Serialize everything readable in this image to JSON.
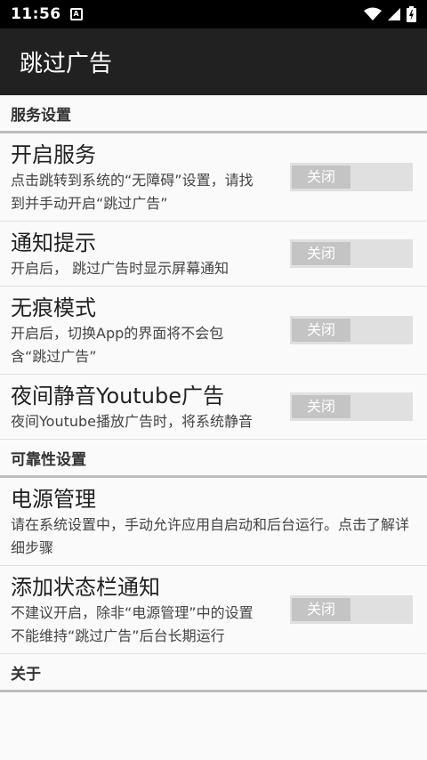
{
  "status_bar": {
    "time": "11:56",
    "notification_letter": "A"
  },
  "app_bar": {
    "title": "跳过广告"
  },
  "sections": {
    "service": {
      "header": "服务设置",
      "items": [
        {
          "title": "开启服务",
          "summary": "点击跳转到系统的“无障碍”设置，请找到并手动开启“跳过广告”",
          "switch": "关闭"
        },
        {
          "title": "通知提示",
          "summary": "开启后， 跳过广告时显示屏幕通知",
          "switch": "关闭"
        },
        {
          "title": "无痕模式",
          "summary": "开启后，切换App的界面将不会包含“跳过广告”",
          "switch": "关闭"
        },
        {
          "title": "夜间静音Youtube广告",
          "summary": "夜间Youtube播放广告时，将系统静音",
          "switch": "关闭"
        }
      ]
    },
    "reliability": {
      "header": "可靠性设置",
      "items": [
        {
          "title": "电源管理",
          "summary": "请在系统设置中，手动允许应用自启动和后台运行。点击了解详细步骤"
        },
        {
          "title": "添加状态栏通知",
          "summary": "不建议开启，除非“电源管理”中的设置不能维持“跳过广告”后台长期运行",
          "switch": "关闭"
        }
      ]
    },
    "about": {
      "header": "关于"
    }
  }
}
